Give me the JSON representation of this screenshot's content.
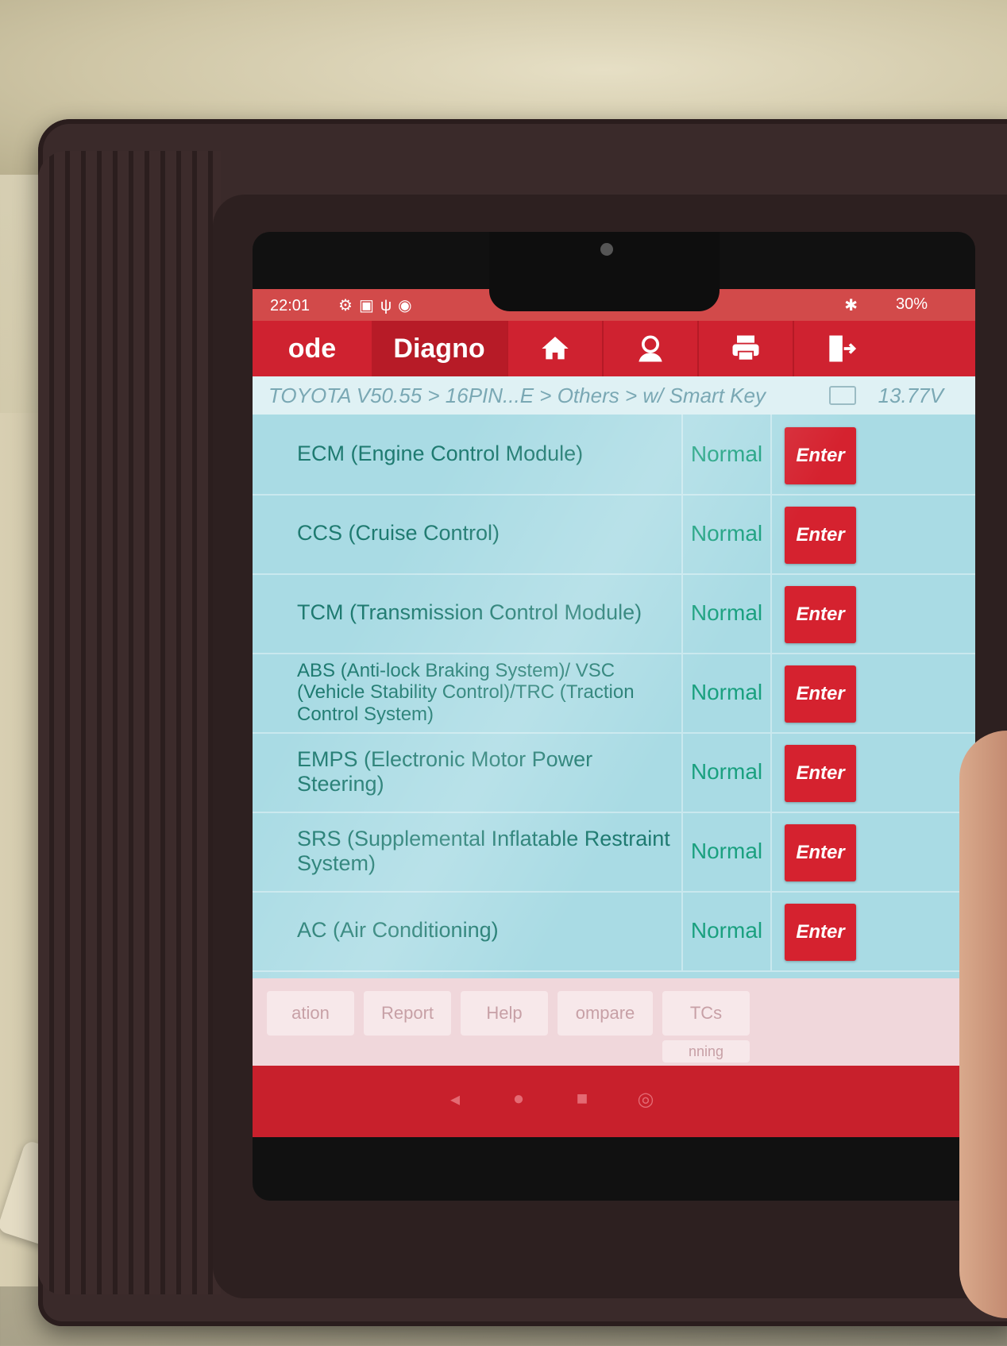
{
  "status_bar": {
    "time": "22:01",
    "battery": "30%"
  },
  "top_bar": {
    "tab_code": "ode",
    "tab_diagnose": "Diagno",
    "home_icon": "home-icon",
    "support_icon": "support-agent-icon",
    "print_icon": "printer-icon",
    "exit_icon": "exit-icon"
  },
  "breadcrumb": {
    "path": "TOYOTA V50.55 > 16PIN...E > Others > w/ Smart Key",
    "voltage": "13.77V"
  },
  "modules": [
    {
      "name": "ECM (Engine Control Module)",
      "status": "Normal",
      "action": "Enter"
    },
    {
      "name": "CCS (Cruise Control)",
      "status": "Normal",
      "action": "Enter"
    },
    {
      "name": "TCM (Transmission Control Module)",
      "status": "Normal",
      "action": "Enter"
    },
    {
      "name": "ABS (Anti-lock Braking System)/ VSC (Vehicle Stability Control)/TRC (Traction Control System)",
      "status": "Normal",
      "action": "Enter"
    },
    {
      "name": "EMPS (Electronic Motor Power Steering)",
      "status": "Normal",
      "action": "Enter"
    },
    {
      "name": "SRS (Supplemental Inflatable Restraint System)",
      "status": "Normal",
      "action": "Enter"
    },
    {
      "name": "AC (Air Conditioning)",
      "status": "Normal",
      "action": "Enter"
    }
  ],
  "bottom_bar": {
    "btn_1": "ation",
    "btn_2": "Report",
    "btn_3": "Help",
    "btn_4": "ompare",
    "btn_5": "TCs",
    "btn_6": "nning"
  },
  "colors": {
    "brand_red": "#cf2230",
    "list_bg": "#a9dbe4",
    "status_green": "#1aa07f"
  }
}
